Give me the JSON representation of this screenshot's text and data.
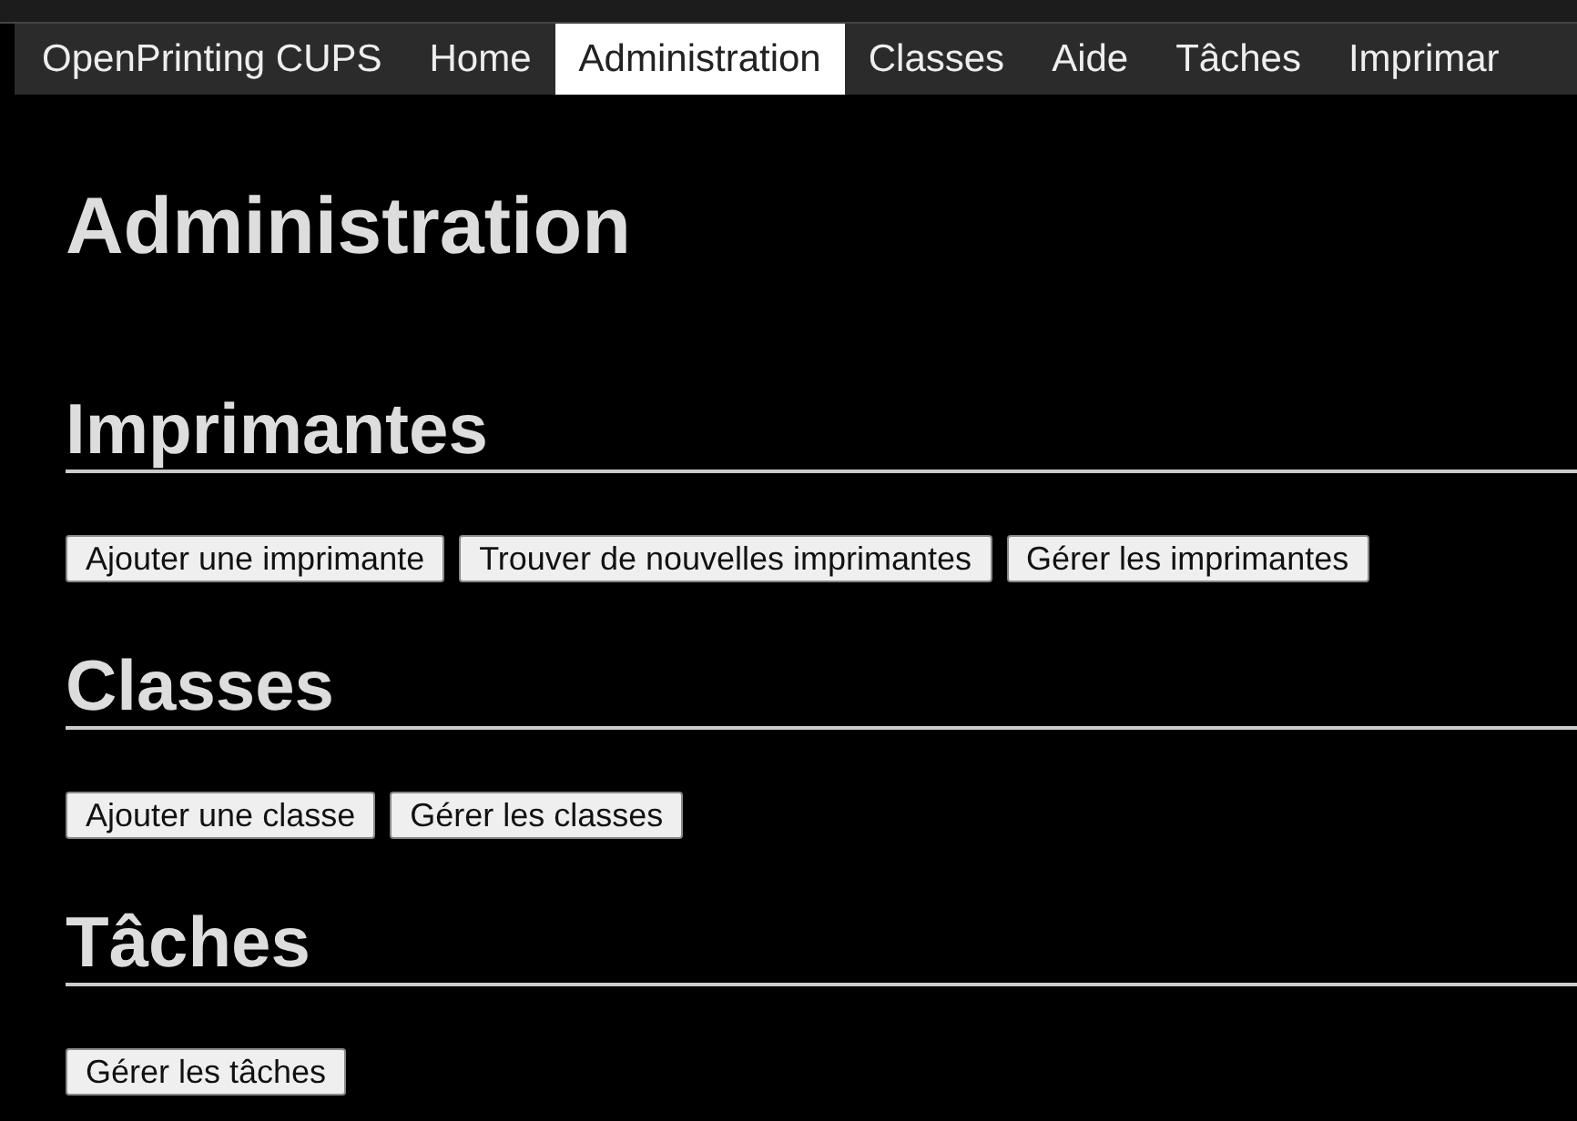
{
  "nav": [
    {
      "label": "OpenPrinting CUPS",
      "selected": false
    },
    {
      "label": "Home",
      "selected": false
    },
    {
      "label": "Administration",
      "selected": true
    },
    {
      "label": "Classes",
      "selected": false
    },
    {
      "label": "Aide",
      "selected": false
    },
    {
      "label": "Tâches",
      "selected": false
    },
    {
      "label": "Imprimar",
      "selected": false
    }
  ],
  "title": "Administration",
  "sections": [
    {
      "heading": "Imprimantes",
      "buttons": [
        "Ajouter une imprimante",
        "Trouver de nouvelles imprimantes",
        "Gérer les imprimantes"
      ]
    },
    {
      "heading": "Classes",
      "buttons": [
        "Ajouter une classe",
        "Gérer les classes"
      ]
    },
    {
      "heading": "Tâches",
      "buttons": [
        "Gérer les tâches"
      ]
    }
  ]
}
